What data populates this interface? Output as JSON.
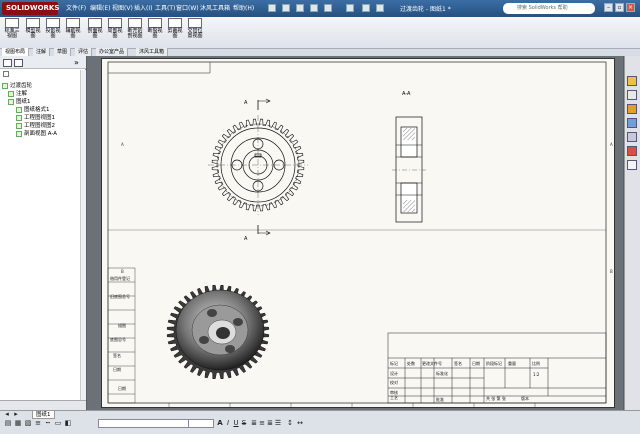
{
  "titlebar": {
    "logo": "SOLIDWORKS",
    "menus": [
      "文件(F)",
      "编辑(E)",
      "视图(V)",
      "插入(I)",
      "工具(T)",
      "窗口(W)",
      "沐风工具箱",
      "帮助(H)"
    ],
    "document_title": "过渡齿轮 - 图纸1 *",
    "search_placeholder": "搜索 SolidWorks 帮助"
  },
  "ribbon": {
    "buttons": [
      "标准三视图",
      "模型视图",
      "投影视图",
      "辅助视图",
      "剖面视图",
      "局部视图",
      "断开的剖视图",
      "断裂视图",
      "剪裁视图",
      "交替位置视图"
    ]
  },
  "tabs": [
    "视图布局",
    "注解",
    "草图",
    "评估",
    "办公室产品",
    "沐风工具箱"
  ],
  "tree": {
    "root": "过渡齿轮",
    "items": [
      "注解",
      "图纸1",
      "图纸格式1",
      "工程图视图1",
      "工程图视图2",
      "剖面视图 A-A"
    ]
  },
  "drawing": {
    "section_label": "A-A",
    "cut_label_a": "A",
    "border_marks_left": [
      "A",
      "B"
    ],
    "border_marks_bottom": [
      "8",
      "7",
      "6",
      "5",
      "4",
      "3",
      "2",
      "1"
    ],
    "left_table": [
      "借用件登记",
      "旧底图总号",
      "底图总号",
      "签名",
      "日期"
    ],
    "left_table_extra": [
      "描图",
      "描校",
      "日期"
    ],
    "title_block": {
      "row1": [
        "标记",
        "处数",
        "更改文件号",
        "签名",
        "日期"
      ],
      "design": "设计",
      "standard": "标准化",
      "check": "校对",
      "process": "工艺",
      "review": "审核",
      "approve": "批准",
      "stage_mark": "阶段标记",
      "weight": "重量",
      "ratio": "比例",
      "scale_value": "1:2",
      "sheet_info": "共  张 第  张",
      "version": "版本"
    }
  },
  "statusbar": {
    "sheet_tab": "图纸1"
  }
}
